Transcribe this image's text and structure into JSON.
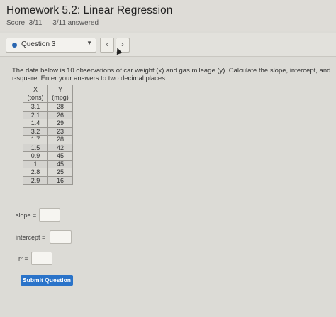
{
  "header": {
    "title": "Homework 5.2: Linear Regression",
    "score": "Score: 3/11",
    "answered": "3/11 answered"
  },
  "question_nav": {
    "selected": "Question 3",
    "prev_glyph": "‹",
    "next_glyph": "›"
  },
  "prompt": "The data below is 10 observations of car weight (x) and gas mileage (y). Calculate the slope, intercept, and r-square. Enter your answers to two decimal places.",
  "table": {
    "headers": [
      {
        "var": "X",
        "unit": "(tons)"
      },
      {
        "var": "Y",
        "unit": "(mpg)"
      }
    ],
    "rows": [
      [
        "3.1",
        "28"
      ],
      [
        "2.1",
        "26"
      ],
      [
        "1.4",
        "29"
      ],
      [
        "3.2",
        "23"
      ],
      [
        "1.7",
        "28"
      ],
      [
        "1.5",
        "42"
      ],
      [
        "0.9",
        "45"
      ],
      [
        "1",
        "45"
      ],
      [
        "2.8",
        "25"
      ],
      [
        "2.9",
        "16"
      ]
    ]
  },
  "answers": {
    "slope_label": "slope =",
    "slope_value": "",
    "intercept_label": "intercept =",
    "intercept_value": "",
    "r2_label": "r² =",
    "r2_value": ""
  },
  "submit_label": "Submit Question",
  "colors": {
    "accent": "#2a73c9",
    "dot": "#2a66b0",
    "background": "#dcdbd6"
  }
}
